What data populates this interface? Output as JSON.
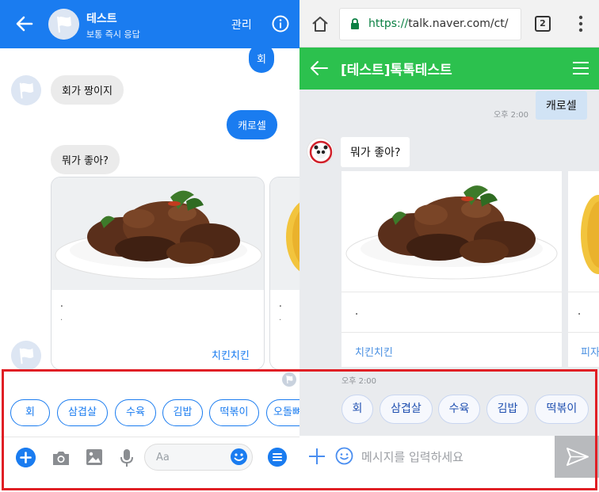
{
  "colors": {
    "messenger_blue": "#1a7cf0",
    "naver_green": "#2cc14e",
    "highlight_red": "#e01f25",
    "naver_chip_text": "#1f4fb0"
  },
  "left": {
    "header": {
      "title": "테스트",
      "subtitle": "보통 즉시 응답",
      "manage_label": "관리",
      "back_icon": "arrow-left-icon",
      "info_icon": "info-icon"
    },
    "messages": [
      {
        "side": "out",
        "text": "회"
      },
      {
        "side": "in",
        "text": "회가 짱이지"
      },
      {
        "side": "out",
        "text": "캐로셀"
      },
      {
        "side": "in",
        "text": "뭐가 좋아?"
      }
    ],
    "carousel": [
      {
        "dot1": ".",
        "dot2": ".",
        "link": "치킨치킨"
      },
      {
        "dot1": ".",
        "dot2": ".",
        "link": ""
      }
    ],
    "quick_replies": [
      "회",
      "삼겹살",
      "수육",
      "김밥",
      "떡볶이",
      "오돌뼈"
    ],
    "composer": {
      "placeholder": "Aa",
      "icons": [
        "plus-icon",
        "camera-icon",
        "image-icon",
        "microphone-icon",
        "smile-icon",
        "menu-icon"
      ]
    }
  },
  "right": {
    "browser": {
      "url_scheme": "https://",
      "url_rest": "talk.naver.com/ct/",
      "tab_count": "2"
    },
    "header": {
      "title": "[테스트]톡톡테스트",
      "back_icon": "arrow-left-icon",
      "menu_icon": "hamburger-icon"
    },
    "messages": [
      {
        "side": "out",
        "text": "캐로셀",
        "time": "오후 2:00"
      },
      {
        "side": "in",
        "text": "뭐가 좋아?"
      }
    ],
    "carousel": [
      {
        "dot": ".",
        "link": "치킨치킨"
      },
      {
        "dot": ".",
        "link": "피자"
      }
    ],
    "carousel_time": "오후 2:00",
    "quick_replies": [
      "회",
      "삼겹살",
      "수육",
      "김밥",
      "떡볶이"
    ],
    "composer": {
      "placeholder": "메시지를 입력하세요",
      "icons": [
        "plus-icon",
        "smile-icon",
        "send-icon"
      ]
    }
  }
}
